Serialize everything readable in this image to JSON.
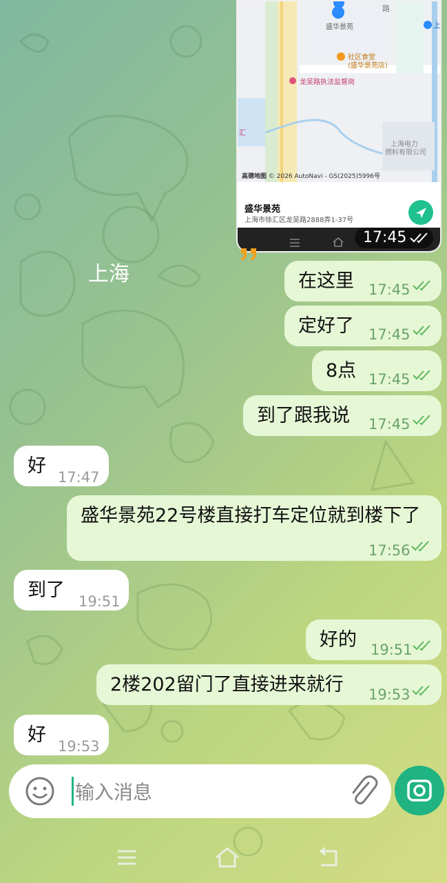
{
  "map": {
    "poi_name": "盛华景苑",
    "poi_address": "上海市徐汇区龙吴路2888弄1-37号",
    "map_label_top": "盛华景苑",
    "label_canteen_1": "社区食堂",
    "label_canteen_2": "(盛华景苑店)",
    "label_police": "龙吴路执法监督岗",
    "label_power_1": "上海电力",
    "label_power_2": "燃料有限公司",
    "label_road": "路",
    "label_right": "上",
    "label_left": "汇",
    "brand": "高德地图",
    "copyright": "© 2026 AutoNavi - GS(2025)5996号",
    "time": "17:45"
  },
  "city_label": "上海",
  "messages": [
    {
      "dir": "out",
      "text": "在这里",
      "time": "17:45"
    },
    {
      "dir": "out",
      "text": "定好了",
      "time": "17:45"
    },
    {
      "dir": "out",
      "text": "8点",
      "time": "17:45"
    },
    {
      "dir": "out",
      "text": "到了跟我说",
      "time": "17:45"
    },
    {
      "dir": "in",
      "text": "好",
      "time": "17:47"
    },
    {
      "dir": "out",
      "text": "盛华景苑22号楼直接打车定位就到楼下了",
      "time": "17:56"
    },
    {
      "dir": "in",
      "text": "到了",
      "time": "19:51"
    },
    {
      "dir": "out",
      "text": "好的",
      "time": "19:51"
    },
    {
      "dir": "out",
      "text": "2楼202留门了直接进来就行",
      "time": "19:53"
    },
    {
      "dir": "in",
      "text": "好",
      "time": "19:53"
    }
  ],
  "input": {
    "placeholder": "输入消息"
  },
  "icons": {
    "emoji": "emoji-icon",
    "attach": "paperclip-icon",
    "camera": "camera-icon",
    "nav_menu": "menu-icon",
    "nav_home": "home-icon",
    "nav_back": "back-icon"
  },
  "colors": {
    "outgoing_bubble": "#e6f7d6",
    "incoming_bubble": "#ffffff",
    "accent": "#1fb481",
    "check": "#5cb85c"
  }
}
